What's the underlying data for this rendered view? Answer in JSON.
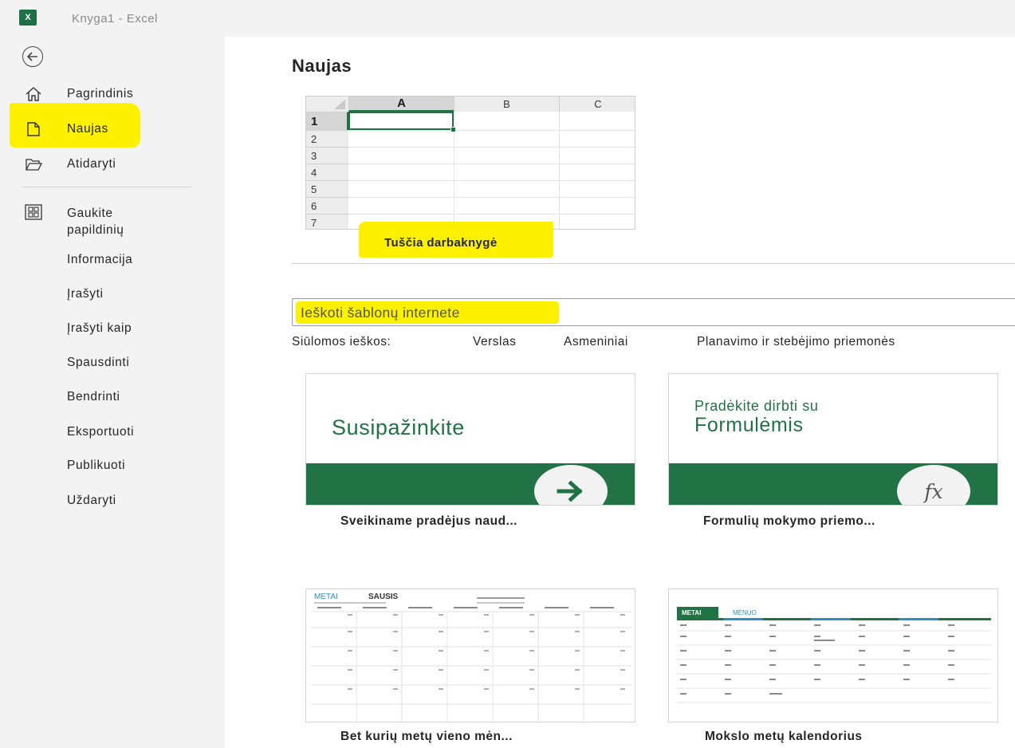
{
  "window": {
    "title": "Knyga1  -  Excel",
    "logo_text": "X"
  },
  "sidebar": {
    "items": [
      {
        "label": "Pagrindinis",
        "icon": "home-icon"
      },
      {
        "label": "Naujas",
        "icon": "new-document-icon"
      },
      {
        "label": "Atidaryti",
        "icon": "folder-open-icon"
      },
      {
        "label": "Gaukite\npapildinių",
        "icon": "add-ins-icon"
      },
      {
        "label": "Informacija"
      },
      {
        "label": "Įrašyti"
      },
      {
        "label": "Įrašyti kaip"
      },
      {
        "label": "Spausdinti"
      },
      {
        "label": "Bendrinti"
      },
      {
        "label": "Eksportuoti"
      },
      {
        "label": "Publikuoti"
      },
      {
        "label": "Uždaryti"
      }
    ]
  },
  "main": {
    "title": "Naujas",
    "blank_workbook": {
      "label": "Tuščia darbaknygė",
      "columns": [
        "A",
        "B",
        "C"
      ],
      "rows": [
        "1",
        "2",
        "3",
        "4",
        "5",
        "6",
        "7"
      ]
    },
    "search": {
      "placeholder": "Ieškoti šablonų internete"
    },
    "suggested": {
      "label": "Siūlomos ieškos:",
      "items": [
        "Verslas",
        "Asmeniniai",
        "Planavimo ir stebėjimo priemonės"
      ]
    },
    "templates": [
      {
        "label": "Sveikiname pradėjus naud...",
        "headline": "Susipažinkite"
      },
      {
        "label": "Formulių mokymo priemo...",
        "headline_small": "Pradėkite dirbti su",
        "headline": "Formulėmis",
        "badge": "fx"
      },
      {
        "label": "Bet kurių metų vieno mėn...",
        "cal_year": "METAI",
        "cal_month": "SAUSIS"
      },
      {
        "label": "Mokslo metų kalendorius",
        "cal_year": "METAI",
        "cal_month": "MĖNUO"
      }
    ]
  },
  "colors": {
    "excel_green": "#217346",
    "highlight_yellow": "#fdf100",
    "chrome_gray": "#f3f3f3"
  }
}
